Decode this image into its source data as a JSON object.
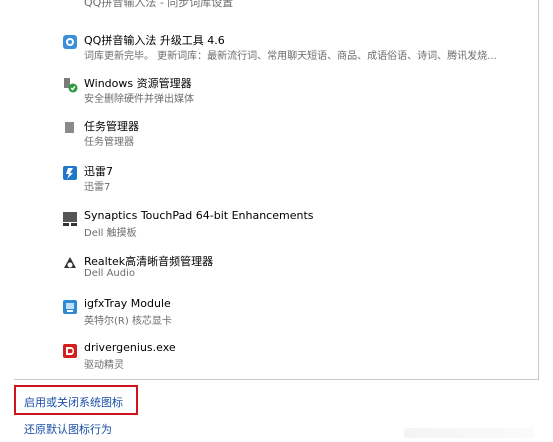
{
  "partial_text": "QQ拼音输入法 - 同步词库设置",
  "items": [
    {
      "title": "QQ拼音输入法 升级工具 4.6",
      "subtitle": "词库更新完毕。  更新词库：最新流行词、常用聊天短语、商品、成语俗语、诗词、腾讯发烧...",
      "icon": "qq-pinyin-icon"
    },
    {
      "title": "Windows 资源管理器",
      "subtitle": "安全删除硬件并弹出媒体",
      "icon": "safely-remove-hardware-icon"
    },
    {
      "title": "任务管理器",
      "subtitle": "任务管理器",
      "icon": "task-manager-icon"
    },
    {
      "title": "迅雷7",
      "subtitle": "迅雷7",
      "icon": "xunlei-icon"
    },
    {
      "title": "Synaptics TouchPad 64-bit Enhancements",
      "subtitle": "Dell 触摸板",
      "icon": "touchpad-icon"
    },
    {
      "title": "Realtek高清晰音频管理器",
      "subtitle": "Dell Audio",
      "icon": "realtek-audio-icon"
    },
    {
      "title": "igfxTray Module",
      "subtitle": "英特尔(R) 核芯显卡",
      "icon": "intel-graphics-icon"
    },
    {
      "title": "drivergenius.exe",
      "subtitle": "驱动精灵",
      "icon": "driver-genius-icon"
    }
  ],
  "links": {
    "toggle_system_icons": "启用或关闭系统图标",
    "restore_default": "还原默认图标行为"
  },
  "colors": {
    "link": "#1a4fa8",
    "highlight": "#d0121a",
    "subtitle": "#6d6d6d"
  }
}
